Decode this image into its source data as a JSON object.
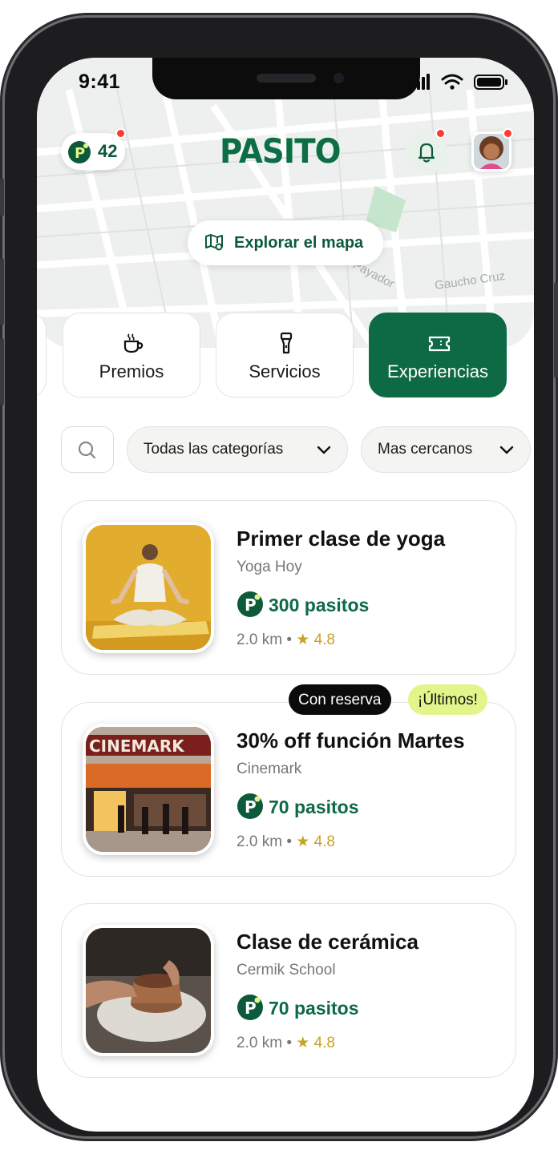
{
  "status_bar": {
    "time": "9:41"
  },
  "header": {
    "points": "42",
    "logo": "PASITO",
    "explore_label": "Explorar el mapa"
  },
  "map_labels": [
    "Gaucho Cruz",
    "Payador"
  ],
  "tabs": [
    {
      "label": "Premios",
      "icon": "coffee-cup-icon",
      "active": false
    },
    {
      "label": "Servicios",
      "icon": "flashlight-icon",
      "active": false
    },
    {
      "label": "Experiencias",
      "icon": "ticket-icon",
      "active": true
    }
  ],
  "filters": {
    "category": "Todas las categorías",
    "sort": "Mas cercanos"
  },
  "cards": [
    {
      "title": "Primer clase de yoga",
      "brand": "Yoga Hoy",
      "points": "300 pasitos",
      "distance": "2.0 km",
      "rating": "4.8",
      "badges": []
    },
    {
      "title": "30% off función Martes",
      "brand": "Cinemark",
      "points": "70 pasitos",
      "distance": "2.0 km",
      "rating": "4.8",
      "badges": [
        "Con reserva",
        "¡Últimos!"
      ]
    },
    {
      "title": "Clase de cerámica",
      "brand": "Cermik School",
      "points": "70 pasitos",
      "distance": "2.0 km",
      "rating": "4.8",
      "badges": []
    }
  ],
  "colors": {
    "brand_green": "#0d6a44",
    "notification_red": "#ff3b30",
    "rating_gold": "#c9a227",
    "badge_lime": "#e1f58a"
  }
}
